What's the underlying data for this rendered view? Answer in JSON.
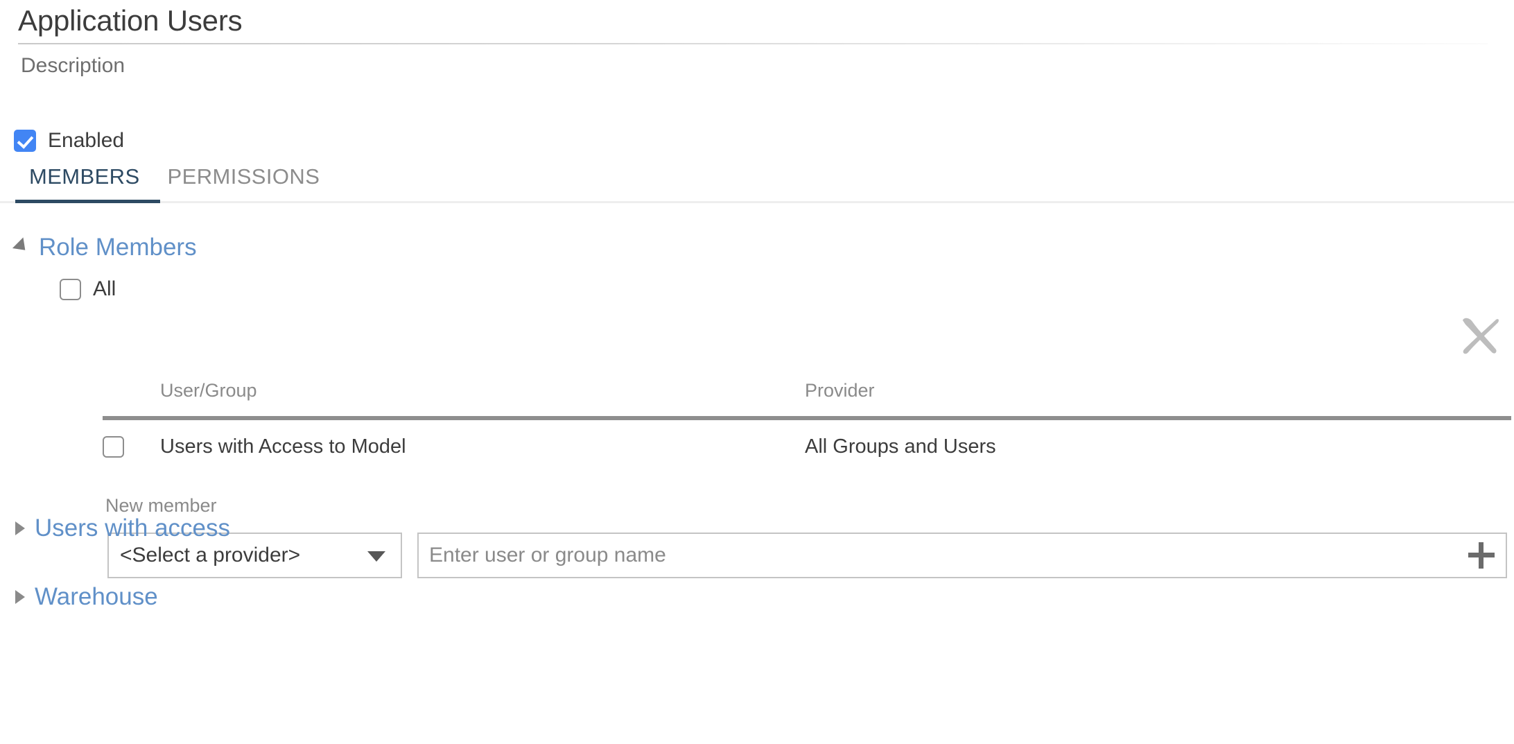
{
  "header": {
    "title": "Application Users",
    "description": "Description"
  },
  "enabled": {
    "label": "Enabled",
    "checked": true
  },
  "tabs": [
    {
      "label": "MEMBERS",
      "active": true
    },
    {
      "label": "PERMISSIONS",
      "active": false
    }
  ],
  "sections": {
    "role_members": {
      "label": "Role Members",
      "expanded": true,
      "all_label": "All",
      "all_checked": false
    },
    "users_with_access": {
      "label": "Users with access",
      "expanded": false
    },
    "warehouse": {
      "label": "Warehouse",
      "expanded": false
    }
  },
  "members_table": {
    "columns": [
      "User/Group",
      "Provider"
    ],
    "rows": [
      {
        "checked": false,
        "user_group": "Users with Access to Model",
        "provider": "All Groups and Users"
      }
    ]
  },
  "new_member": {
    "label": "New member",
    "provider_selected": "<Select a provider>",
    "name_value": "",
    "name_placeholder": "Enter user or group name",
    "add_icon": "plus-icon"
  },
  "icons": {
    "delete": "close-x-icon",
    "dropdown": "chevron-down-icon",
    "expanded": "triangle-down-icon",
    "collapsed": "triangle-right-icon"
  },
  "colors": {
    "accent_blue": "#4285F4",
    "link_blue": "#6090c8",
    "tab_active": "#2d4a63",
    "muted_gray": "#8a8a8a",
    "text": "#3c3c3c"
  }
}
